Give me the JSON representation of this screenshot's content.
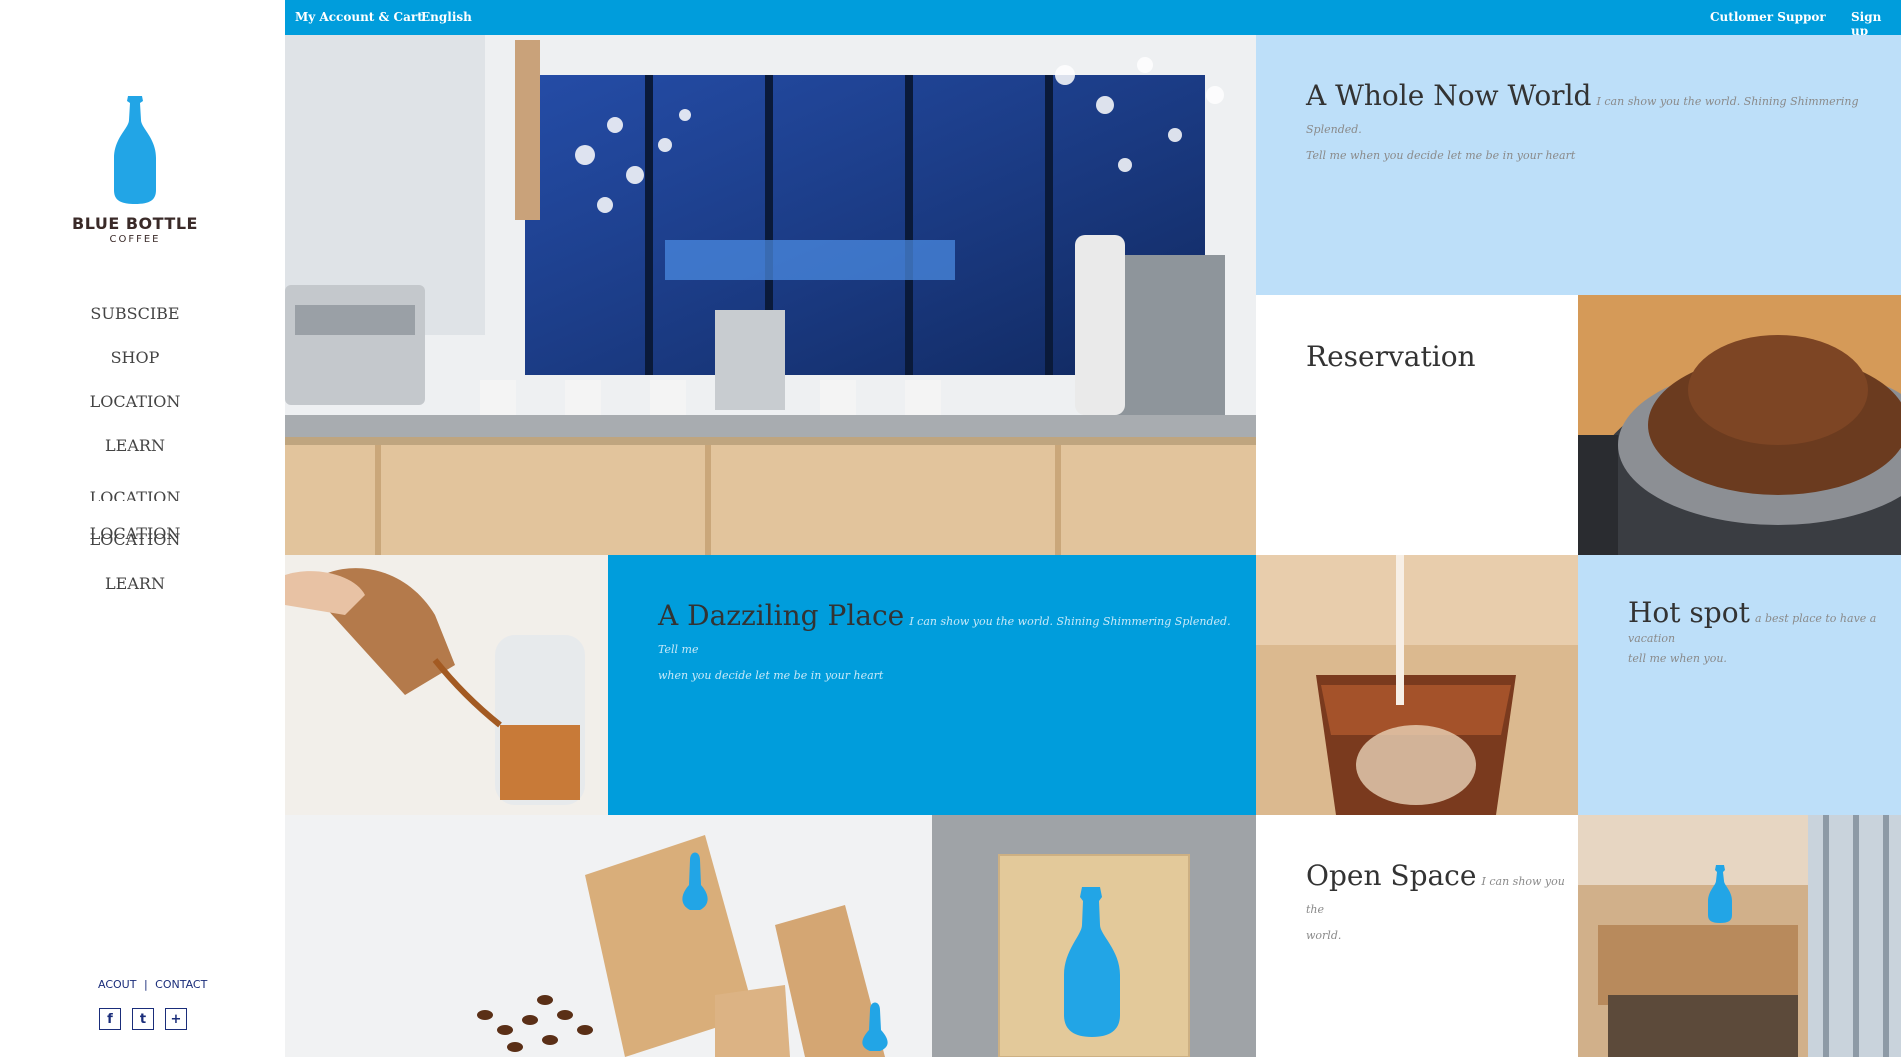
{
  "brand": {
    "name": "BLUE BOTTLE",
    "sub": "COFFEE"
  },
  "nav": [
    "SUBSCIBE",
    "SHOP",
    "LOCATION",
    "LEARN",
    "LOCATION",
    "LOCATION",
    "LOCATION",
    "LEARN"
  ],
  "footer": {
    "about": "ACOUT",
    "separator": "|",
    "contact": "CONTACT"
  },
  "social": [
    "facebook",
    "twitter",
    "plus"
  ],
  "topbar": {
    "account": "My Account & Cart",
    "language": "English",
    "support": "Cutlomer Suppor",
    "signup": "Sign up"
  },
  "panels": {
    "whole": {
      "title": "A Whole Now World",
      "small1": "I can show you the world. Shining Shimmering Splended.",
      "small2": "Tell me when you decide let me be in your heart"
    },
    "reservation": {
      "title": "Reservation"
    },
    "dazzling": {
      "title": "A Dazziling Place",
      "small1": "I can show you the world. Shining Shimmering Splended. Tell me",
      "small2": "when you decide let me be in your heart"
    },
    "hotspot": {
      "title": "Hot spot",
      "small1": "a best place to have a",
      "small2": "vacation",
      "small3": "tell me when you."
    },
    "open": {
      "title": "Open Space",
      "small1": "I can show you the",
      "small2": "world."
    }
  },
  "colors": {
    "accent": "#009ddc",
    "light": "#bddff9",
    "text": "#333333",
    "muted": "#8a8a8a",
    "navy": "#1a2d7a"
  },
  "icons": [
    "bottle-logo-icon",
    "facebook-icon",
    "twitter-icon",
    "plus-icon"
  ]
}
